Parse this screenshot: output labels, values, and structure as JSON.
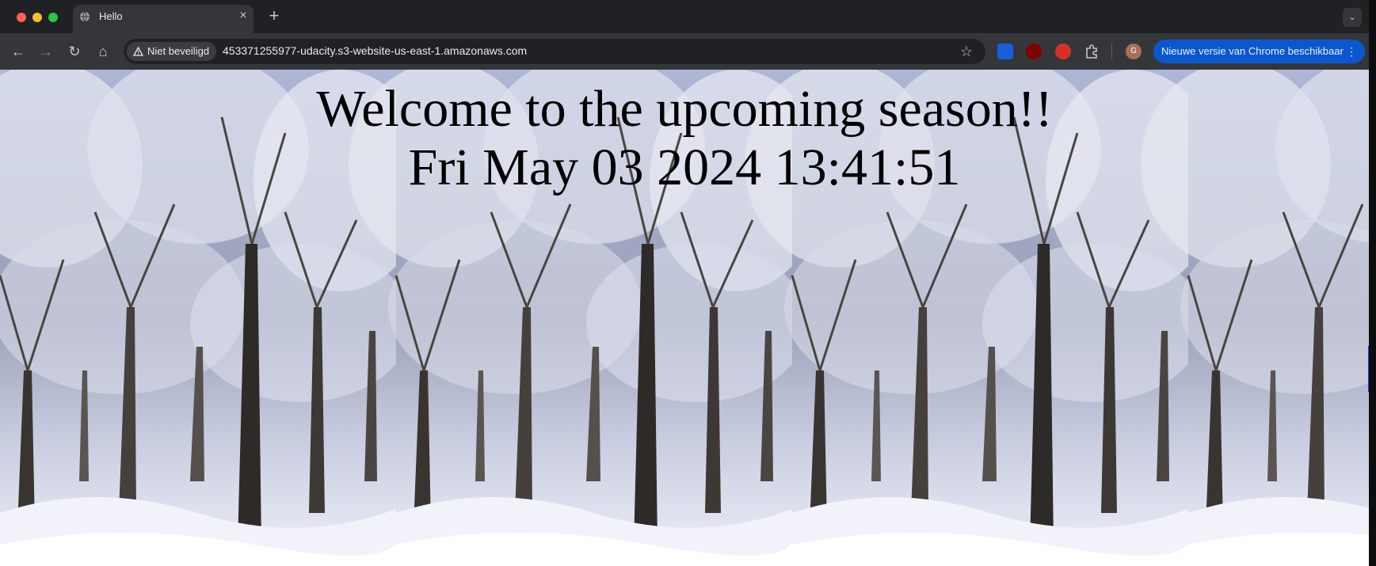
{
  "browser": {
    "tab": {
      "title": "Hello",
      "favicon": "globe-icon",
      "close": "×"
    },
    "new_tab": "+",
    "tab_search": "⌄",
    "nav": {
      "back": "←",
      "forward": "→",
      "reload": "↻",
      "home": "⌂"
    },
    "security_label": "Niet beveiligd",
    "url": "453371255977-udacity.s3-website-us-east-1.amazonaws.com",
    "bookmark": "☆",
    "extensions": [
      "bitwarden-icon",
      "ublock-icon",
      "red-hand-icon",
      "puzzle-icon"
    ],
    "profile_initial": "G",
    "update_label": "Nieuwe versie van Chrome beschikbaar",
    "update_menu": "⋮",
    "colors": {
      "update_chip": "#0b57d0",
      "tab_active": "#35363a"
    }
  },
  "page": {
    "title": "Welcome to the upcoming season!!",
    "datetime": "Fri May 03 2024 13:41:51",
    "background": "snowy-forest-image"
  }
}
